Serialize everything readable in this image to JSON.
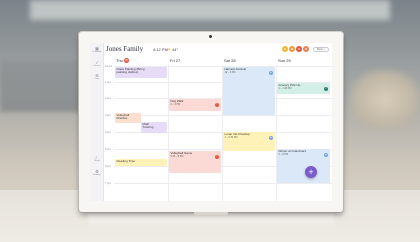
{
  "header": {
    "title": "Jones Family",
    "time": "4:12 PM",
    "temperature": "44°",
    "weather_icon": "sun-icon",
    "avatars": [
      {
        "initial": "A",
        "color": "#f2b632"
      },
      {
        "initial": "B",
        "color": "#f29b38"
      },
      {
        "initial": "C",
        "color": "#e4573d"
      },
      {
        "initial": "D",
        "color": "#f07d52"
      }
    ],
    "menu_label": "Menu ≡"
  },
  "sidebar": [
    {
      "icon": "calendar-icon",
      "glyph": "▦",
      "label": "Calendar"
    },
    {
      "icon": "chores-icon",
      "glyph": "✓",
      "label": "Chores"
    },
    {
      "icon": "lists-icon",
      "glyph": "☰",
      "label": "Lists"
    },
    {
      "icon": "sleep-icon",
      "glyph": "☾",
      "label": "Sleep"
    },
    {
      "icon": "settings-icon",
      "glyph": "⚙",
      "label": "Settings"
    }
  ],
  "days": [
    {
      "label": "Thu",
      "badge": "26",
      "today": true
    },
    {
      "label": "Fri 27"
    },
    {
      "label": "Sat 28"
    },
    {
      "label": "Sun 29"
    }
  ],
  "hours": [
    "12 pm",
    "1 pm",
    "2 pm",
    "3 pm",
    "4 pm",
    "5 pm",
    "6 pm",
    "7 pm"
  ],
  "events": [
    {
      "title": "Class Painting (Bring",
      "subtitle": "painting clothes)",
      "color": "#e7dcf7"
    },
    {
      "title": "Volleyball",
      "subtitle": "Practice",
      "color": "#fbe0cf"
    },
    {
      "title": "Math",
      "subtitle": "Tutoring",
      "color": "#e7dcf7"
    },
    {
      "title": "Reading Time",
      "subtitle": "",
      "color": "#fff2b8"
    },
    {
      "title": "Dog Walk",
      "subtitle": "2 – 3 PM",
      "color": "#fbd9d4"
    },
    {
      "title": "Volleyball Game",
      "subtitle": "5:30 – 8 PM",
      "color": "#fbd9d4"
    },
    {
      "title": "Harvest Festival",
      "subtitle": "12 – 3 PM",
      "color": "#dbe8f7"
    },
    {
      "title": "Lunar Vet Checkup",
      "subtitle": "4 – 5:30 PM",
      "color": "#fff2b8"
    },
    {
      "title": "Grocery Pick Up",
      "subtitle": "1 – 1:45 PM",
      "color": "#d4efe7"
    },
    {
      "title": "Dinner at Grandma's",
      "subtitle": "5 – 8 PM",
      "color": "#dbe8f7"
    }
  ],
  "fab_label": "+",
  "colors": {
    "accent": "#7b5ccd",
    "today": "#e4573d"
  }
}
